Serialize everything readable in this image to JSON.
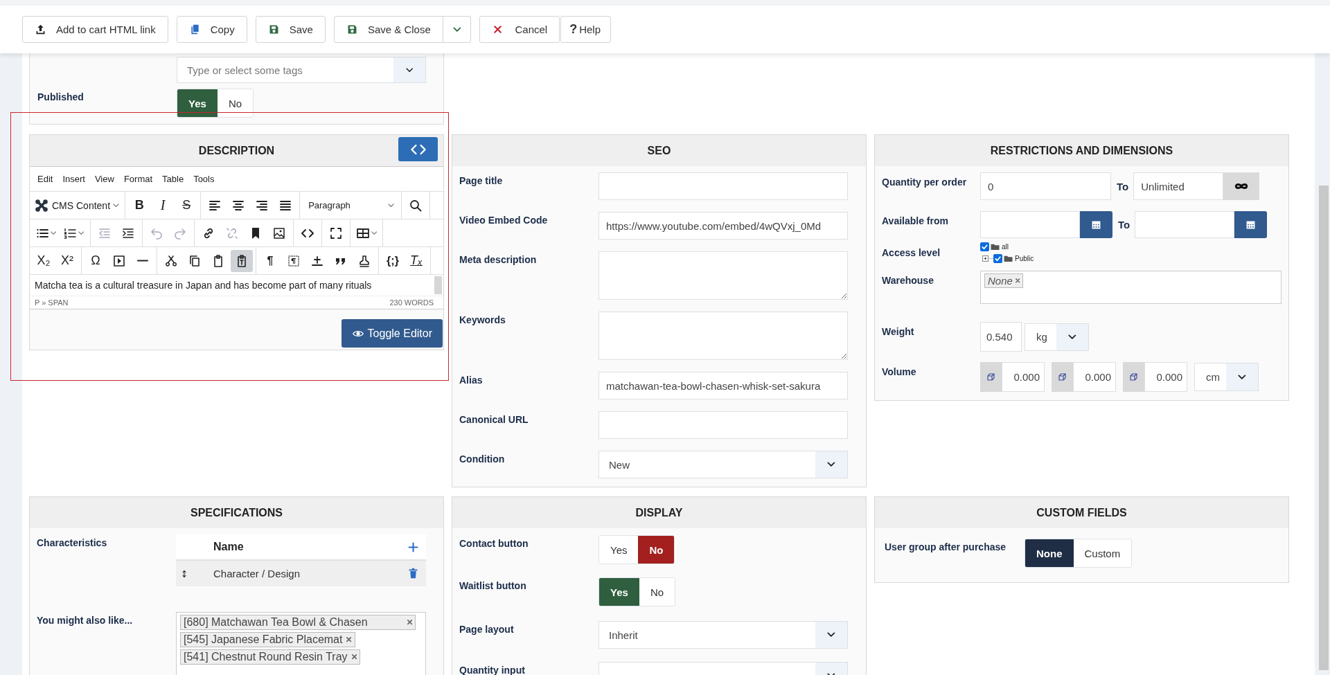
{
  "toolbar": {
    "buttons": [
      {
        "label": "Add to cart HTML link",
        "kind": "upload"
      },
      {
        "label": "Copy",
        "kind": "copy"
      },
      {
        "label": "Save",
        "kind": "save"
      },
      {
        "label": "Save & Close",
        "kind": "save-menu"
      },
      {
        "label": "Cancel",
        "kind": "cancel"
      },
      {
        "label": "Help",
        "kind": "help",
        "icon_text": "?"
      }
    ]
  },
  "basic": {
    "tags": {
      "placeholder": "Type or select some tags"
    },
    "published": {
      "label": "Published",
      "options": [
        {
          "label": "Yes",
          "selected": true,
          "color": "#2f5f3f"
        },
        {
          "label": "No",
          "selected": false
        }
      ]
    }
  },
  "description": {
    "title": "DESCRIPTION",
    "menu": [
      "Edit",
      "Insert",
      "View",
      "Format",
      "Table",
      "Tools"
    ],
    "block_selector": "CMS Content",
    "format_selector": "Paragraph",
    "glyphs": [
      "B",
      "I",
      "S",
      "X₂",
      "X²",
      "Ω",
      "¶",
      "{;}",
      "Tₓ"
    ],
    "outdent": {
      "disabled": true
    },
    "undo": {
      "disabled": true
    },
    "redo": {
      "disabled": true
    },
    "unlink": {
      "disabled": true
    },
    "paste_as_text": {
      "on": true
    },
    "content": "Matcha tea is a cultural treasure in Japan and has become part of many rituals",
    "path": "P » SPAN",
    "word_count": "230 WORDS",
    "toggle_button": "Toggle Editor"
  },
  "seo": {
    "title": "SEO",
    "fields": [
      {
        "label": "Page title",
        "kind": "input"
      },
      {
        "label": "Video Embed Code",
        "kind": "input",
        "value": "https://www.youtube.com/embed/4wQVxj_0Md"
      },
      {
        "label": "Meta description",
        "kind": "textarea"
      },
      {
        "label": "Keywords",
        "kind": "textarea"
      },
      {
        "label": "Alias",
        "kind": "input",
        "value": "matchawan-tea-bowl-chasen-whisk-set-sakura"
      },
      {
        "label": "Canonical URL",
        "kind": "input"
      },
      {
        "label": "Condition",
        "kind": "select",
        "value": "New"
      }
    ]
  },
  "restrictions": {
    "title": "RESTRICTIONS AND DIMENSIONS",
    "quantity": {
      "label": "Quantity per order",
      "min": "0",
      "to": "To",
      "max": "Unlimited"
    },
    "available": {
      "label": "Available from",
      "to": "To"
    },
    "access": {
      "label": "Access level",
      "tree": [
        {
          "label": "all",
          "checked": true,
          "children": [
            {
              "label": "Public",
              "checked": true,
              "expanded": false
            }
          ]
        }
      ]
    },
    "warehouse": {
      "label": "Warehouse",
      "tags": [
        "None"
      ]
    },
    "weight": {
      "label": "Weight",
      "value": "0.540",
      "unit": "kg"
    },
    "volume": {
      "label": "Volume",
      "values": [
        "0.000",
        "0.000",
        "0.000"
      ],
      "unit": "cm"
    }
  },
  "specifications": {
    "title": "SPECIFICATIONS",
    "characteristics": {
      "label": "Characteristics",
      "column": "Name",
      "rows": [
        "Character / Design"
      ]
    },
    "related": {
      "label": "You might also like...",
      "items": [
        "[680] Matchawan Tea Bowl & Chasen",
        "[545] Japanese Fabric Placemat",
        "[541] Chestnut Round Resin Tray"
      ]
    }
  },
  "display": {
    "title": "DISPLAY",
    "fields": [
      {
        "label": "Contact button",
        "kind": "toggle",
        "options": [
          {
            "label": "Yes",
            "selected": false
          },
          {
            "label": "No",
            "selected": true,
            "color": "#a3201f"
          }
        ]
      },
      {
        "label": "Waitlist button",
        "kind": "toggle",
        "options": [
          {
            "label": "Yes",
            "selected": true,
            "color": "#2f5f3f"
          },
          {
            "label": "No",
            "selected": false
          }
        ]
      },
      {
        "label": "Page layout",
        "kind": "select",
        "value": "Inherit"
      },
      {
        "label": "Quantity input",
        "kind": "select"
      }
    ]
  },
  "custom_fields": {
    "title": "CUSTOM FIELDS",
    "fields": [
      {
        "label": "User group after purchase",
        "kind": "toggle",
        "options": [
          {
            "label": "None",
            "selected": true,
            "color": "#1f2d45"
          },
          {
            "label": "Custom",
            "selected": false
          }
        ]
      }
    ]
  }
}
